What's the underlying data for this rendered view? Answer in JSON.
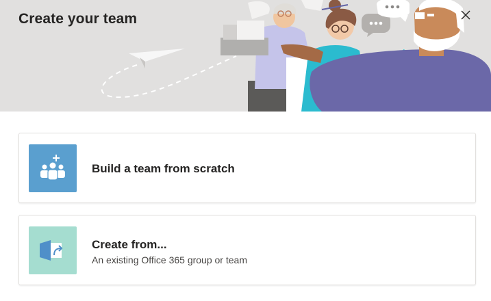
{
  "dialog": {
    "title": "Create your team",
    "close_icon": "close-icon"
  },
  "options": [
    {
      "title": "Build a team from scratch",
      "subtitle": "",
      "icon": "add-team-icon",
      "tile_color": "#5a9fcf"
    },
    {
      "title": "Create from...",
      "subtitle": "An existing Office 365 group or team",
      "icon": "import-group-icon",
      "tile_color": "#a5ddd0"
    }
  ],
  "colors": {
    "header_background": "#e1e0df",
    "text_primary": "#252423",
    "text_secondary": "#484644"
  }
}
